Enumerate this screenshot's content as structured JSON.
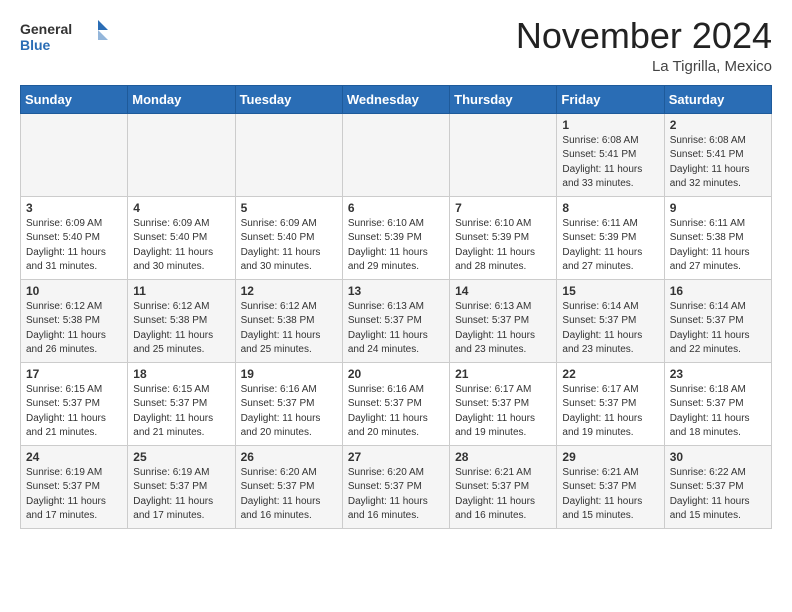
{
  "header": {
    "logo_general": "General",
    "logo_blue": "Blue",
    "month_title": "November 2024",
    "location": "La Tigrilla, Mexico"
  },
  "weekdays": [
    "Sunday",
    "Monday",
    "Tuesday",
    "Wednesday",
    "Thursday",
    "Friday",
    "Saturday"
  ],
  "weeks": [
    [
      {
        "day": "",
        "info": ""
      },
      {
        "day": "",
        "info": ""
      },
      {
        "day": "",
        "info": ""
      },
      {
        "day": "",
        "info": ""
      },
      {
        "day": "",
        "info": ""
      },
      {
        "day": "1",
        "info": "Sunrise: 6:08 AM\nSunset: 5:41 PM\nDaylight: 11 hours\nand 33 minutes."
      },
      {
        "day": "2",
        "info": "Sunrise: 6:08 AM\nSunset: 5:41 PM\nDaylight: 11 hours\nand 32 minutes."
      }
    ],
    [
      {
        "day": "3",
        "info": "Sunrise: 6:09 AM\nSunset: 5:40 PM\nDaylight: 11 hours\nand 31 minutes."
      },
      {
        "day": "4",
        "info": "Sunrise: 6:09 AM\nSunset: 5:40 PM\nDaylight: 11 hours\nand 30 minutes."
      },
      {
        "day": "5",
        "info": "Sunrise: 6:09 AM\nSunset: 5:40 PM\nDaylight: 11 hours\nand 30 minutes."
      },
      {
        "day": "6",
        "info": "Sunrise: 6:10 AM\nSunset: 5:39 PM\nDaylight: 11 hours\nand 29 minutes."
      },
      {
        "day": "7",
        "info": "Sunrise: 6:10 AM\nSunset: 5:39 PM\nDaylight: 11 hours\nand 28 minutes."
      },
      {
        "day": "8",
        "info": "Sunrise: 6:11 AM\nSunset: 5:39 PM\nDaylight: 11 hours\nand 27 minutes."
      },
      {
        "day": "9",
        "info": "Sunrise: 6:11 AM\nSunset: 5:38 PM\nDaylight: 11 hours\nand 27 minutes."
      }
    ],
    [
      {
        "day": "10",
        "info": "Sunrise: 6:12 AM\nSunset: 5:38 PM\nDaylight: 11 hours\nand 26 minutes."
      },
      {
        "day": "11",
        "info": "Sunrise: 6:12 AM\nSunset: 5:38 PM\nDaylight: 11 hours\nand 25 minutes."
      },
      {
        "day": "12",
        "info": "Sunrise: 6:12 AM\nSunset: 5:38 PM\nDaylight: 11 hours\nand 25 minutes."
      },
      {
        "day": "13",
        "info": "Sunrise: 6:13 AM\nSunset: 5:37 PM\nDaylight: 11 hours\nand 24 minutes."
      },
      {
        "day": "14",
        "info": "Sunrise: 6:13 AM\nSunset: 5:37 PM\nDaylight: 11 hours\nand 23 minutes."
      },
      {
        "day": "15",
        "info": "Sunrise: 6:14 AM\nSunset: 5:37 PM\nDaylight: 11 hours\nand 23 minutes."
      },
      {
        "day": "16",
        "info": "Sunrise: 6:14 AM\nSunset: 5:37 PM\nDaylight: 11 hours\nand 22 minutes."
      }
    ],
    [
      {
        "day": "17",
        "info": "Sunrise: 6:15 AM\nSunset: 5:37 PM\nDaylight: 11 hours\nand 21 minutes."
      },
      {
        "day": "18",
        "info": "Sunrise: 6:15 AM\nSunset: 5:37 PM\nDaylight: 11 hours\nand 21 minutes."
      },
      {
        "day": "19",
        "info": "Sunrise: 6:16 AM\nSunset: 5:37 PM\nDaylight: 11 hours\nand 20 minutes."
      },
      {
        "day": "20",
        "info": "Sunrise: 6:16 AM\nSunset: 5:37 PM\nDaylight: 11 hours\nand 20 minutes."
      },
      {
        "day": "21",
        "info": "Sunrise: 6:17 AM\nSunset: 5:37 PM\nDaylight: 11 hours\nand 19 minutes."
      },
      {
        "day": "22",
        "info": "Sunrise: 6:17 AM\nSunset: 5:37 PM\nDaylight: 11 hours\nand 19 minutes."
      },
      {
        "day": "23",
        "info": "Sunrise: 6:18 AM\nSunset: 5:37 PM\nDaylight: 11 hours\nand 18 minutes."
      }
    ],
    [
      {
        "day": "24",
        "info": "Sunrise: 6:19 AM\nSunset: 5:37 PM\nDaylight: 11 hours\nand 17 minutes."
      },
      {
        "day": "25",
        "info": "Sunrise: 6:19 AM\nSunset: 5:37 PM\nDaylight: 11 hours\nand 17 minutes."
      },
      {
        "day": "26",
        "info": "Sunrise: 6:20 AM\nSunset: 5:37 PM\nDaylight: 11 hours\nand 16 minutes."
      },
      {
        "day": "27",
        "info": "Sunrise: 6:20 AM\nSunset: 5:37 PM\nDaylight: 11 hours\nand 16 minutes."
      },
      {
        "day": "28",
        "info": "Sunrise: 6:21 AM\nSunset: 5:37 PM\nDaylight: 11 hours\nand 16 minutes."
      },
      {
        "day": "29",
        "info": "Sunrise: 6:21 AM\nSunset: 5:37 PM\nDaylight: 11 hours\nand 15 minutes."
      },
      {
        "day": "30",
        "info": "Sunrise: 6:22 AM\nSunset: 5:37 PM\nDaylight: 11 hours\nand 15 minutes."
      }
    ]
  ]
}
